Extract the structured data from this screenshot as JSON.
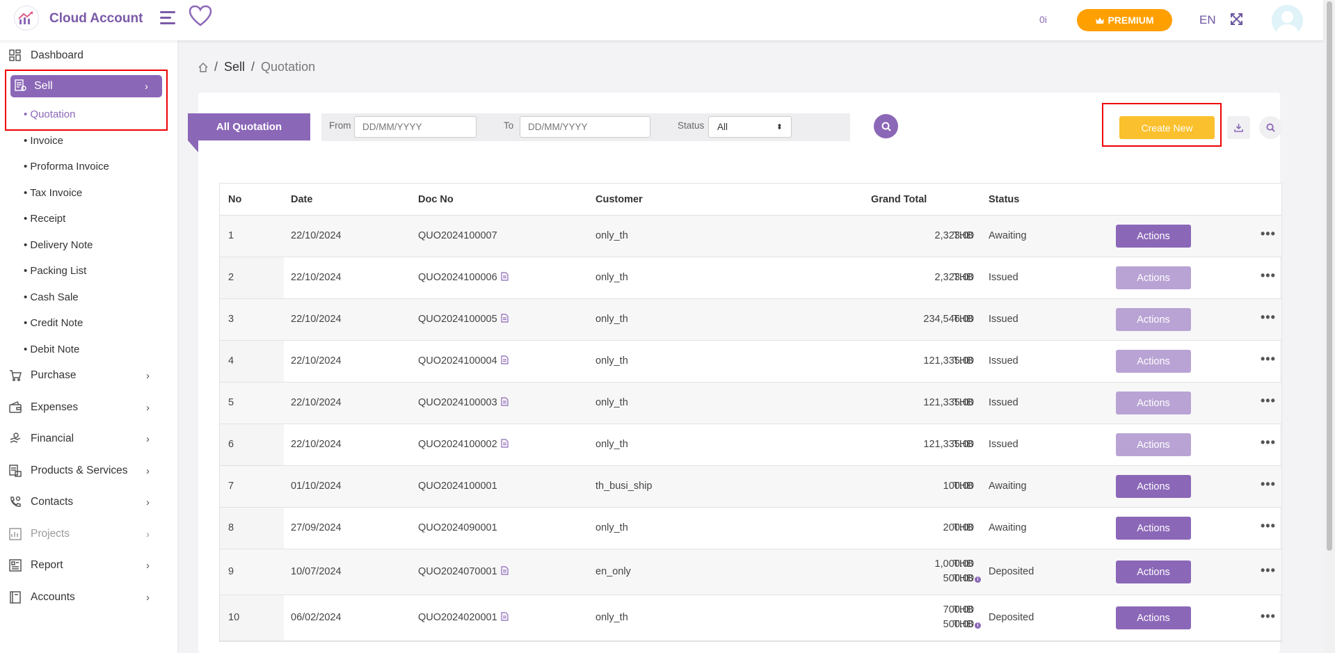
{
  "header": {
    "app_name": "Cloud Account",
    "count": "0i",
    "premium_label": "PREMIUM",
    "language": "EN"
  },
  "sidebar": {
    "dashboard": "Dashboard",
    "sell": "Sell",
    "sub_items": [
      "Quotation",
      "Invoice",
      "Proforma Invoice",
      "Tax Invoice",
      "Receipt",
      "Delivery Note",
      "Packing List",
      "Cash Sale",
      "Credit Note",
      "Debit Note"
    ],
    "groups": [
      "Purchase",
      "Expenses",
      "Financial",
      "Products & Services",
      "Contacts",
      "Projects",
      "Report",
      "Accounts"
    ]
  },
  "breadcrumb": {
    "sell": "Sell",
    "current": "Quotation"
  },
  "toolbar": {
    "tab_label": "All Quotation",
    "from_label": "From",
    "from_placeholder": "DD/MM/YYYY",
    "to_label": "To",
    "to_placeholder": "DD/MM/YYYY",
    "status_label": "Status",
    "status_value": "All",
    "create_label": "Create New"
  },
  "table": {
    "headers": [
      "No",
      "Date",
      "Doc No",
      "Customer",
      "Grand Total",
      "Status"
    ],
    "action_label": "Actions",
    "currency": "THB",
    "rows": [
      {
        "no": "1",
        "date": "22/10/2024",
        "doc": "QUO2024100007",
        "customer": "only_th",
        "total": "2,323.00",
        "status": "Awaiting"
      },
      {
        "no": "2",
        "date": "22/10/2024",
        "doc": "QUO2024100006",
        "customer": "only_th",
        "total": "2,323.00",
        "status": "Issued"
      },
      {
        "no": "3",
        "date": "22/10/2024",
        "doc": "QUO2024100005",
        "customer": "only_th",
        "total": "234,546.00",
        "status": "Issued"
      },
      {
        "no": "4",
        "date": "22/10/2024",
        "doc": "QUO2024100004",
        "customer": "only_th",
        "total": "121,335.00",
        "status": "Issued"
      },
      {
        "no": "5",
        "date": "22/10/2024",
        "doc": "QUO2024100003",
        "customer": "only_th",
        "total": "121,335.00",
        "status": "Issued"
      },
      {
        "no": "6",
        "date": "22/10/2024",
        "doc": "QUO2024100002",
        "customer": "only_th",
        "total": "121,335.00",
        "status": "Issued"
      },
      {
        "no": "7",
        "date": "01/10/2024",
        "doc": "QUO2024100001",
        "customer": "th_busi_ship",
        "total": "100.00",
        "status": "Awaiting"
      },
      {
        "no": "8",
        "date": "27/09/2024",
        "doc": "QUO2024090001",
        "customer": "only_th",
        "total": "200.00",
        "status": "Awaiting"
      },
      {
        "no": "9",
        "date": "10/07/2024",
        "doc": "QUO2024070001",
        "customer": "en_only",
        "total": "1,000.00",
        "deposit": "500.00",
        "status": "Deposited"
      },
      {
        "no": "10",
        "date": "06/02/2024",
        "doc": "QUO2024020001",
        "customer": "only_th",
        "total": "700.00",
        "deposit": "500.00",
        "status": "Deposited"
      }
    ]
  }
}
